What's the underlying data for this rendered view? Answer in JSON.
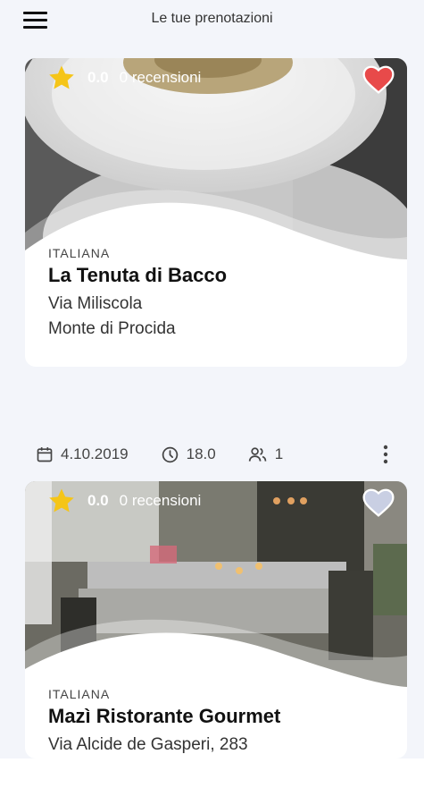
{
  "header": {
    "title": "Le tue prenotazioni"
  },
  "restaurants": [
    {
      "cuisine": "ITALIANA",
      "name": "La Tenuta di Bacco",
      "address_line1": "Via Miliscola",
      "address_line2": "Monte di Procida",
      "rating": "0.0",
      "reviews": "0 recensioni",
      "favorite": true,
      "heart_color": "#e84a4a"
    },
    {
      "cuisine": "ITALIANA",
      "name": "Mazì Ristorante Gourmet",
      "address_line1": "Via Alcide de Gasperi, 283",
      "rating": "0.0",
      "reviews": "0 recensioni",
      "favorite": false,
      "heart_color": "#c9cfe3",
      "booking": {
        "date": "4.10.2019",
        "time": "18.0",
        "guests": "1"
      }
    }
  ],
  "colors": {
    "star": "#f5c518",
    "background": "#f3f5fa"
  },
  "icons": [
    "menu-icon",
    "star-icon",
    "heart-icon",
    "calendar-icon",
    "clock-icon",
    "people-icon",
    "more-vert-icon"
  ]
}
